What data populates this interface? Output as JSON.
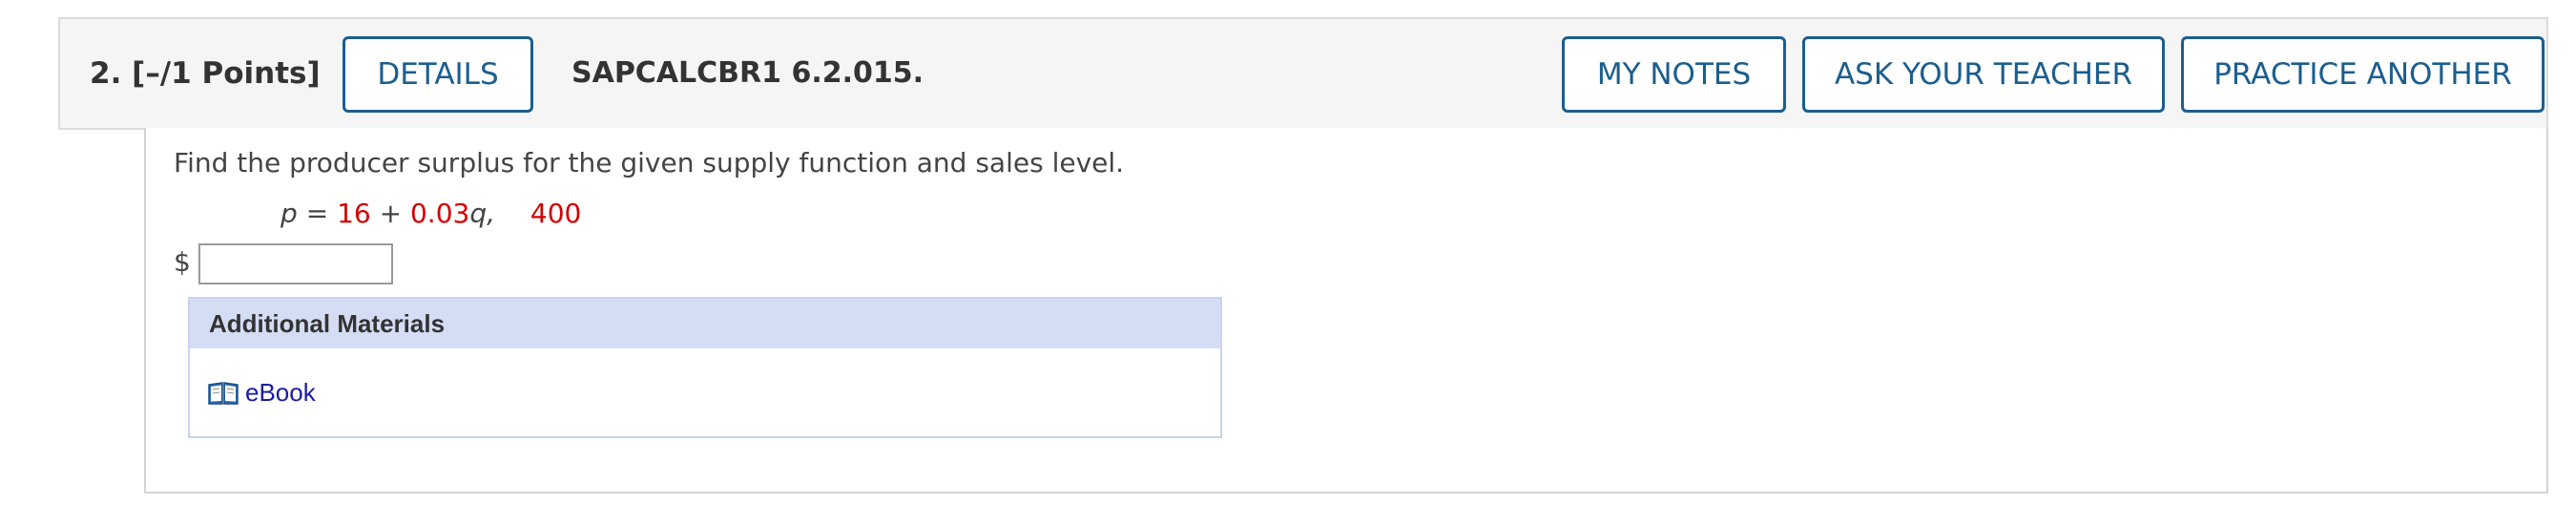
{
  "header": {
    "question_number": "2.",
    "points": "[–/1 Points]",
    "details_label": "DETAILS",
    "question_code": "SAPCALCBR1 6.2.015.",
    "my_notes_label": "MY NOTES",
    "ask_teacher_label": "ASK YOUR TEACHER",
    "practice_another_label": "PRACTICE ANOTHER"
  },
  "question": {
    "prompt": "Find the producer surplus for the given supply function and sales level.",
    "formula": {
      "var_p": "p",
      "equals": "=",
      "const": "16",
      "plus": "+",
      "coef": "0.03",
      "var_q": "q,",
      "sales_level": "400"
    },
    "currency_symbol": "$",
    "answer_value": ""
  },
  "additional_materials": {
    "title": "Additional Materials",
    "items": [
      {
        "label": "eBook",
        "icon": "book-icon"
      }
    ]
  },
  "colors": {
    "accent": "#1b5e8f",
    "highlight_value": "#d40000",
    "link": "#1a1aa6",
    "materials_header_bg": "#d5ddf5"
  }
}
